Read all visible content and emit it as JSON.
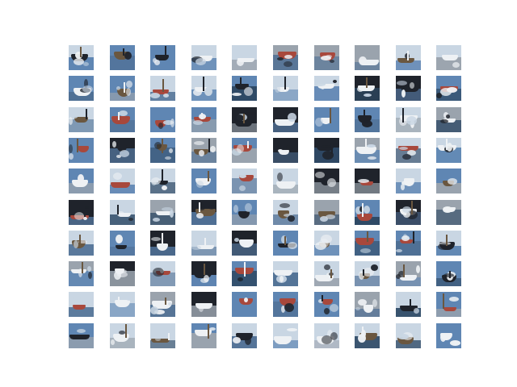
{
  "figure": {
    "background": "#ffffff",
    "rows": 10,
    "cols": 10,
    "subject": "boats / ships",
    "palette": {
      "sky_light": "#c9d6e3",
      "sky_blue": "#5f86b3",
      "sky_grey": "#9aa3ad",
      "sea_dark": "#2f4a66",
      "sea_mid": "#4f6f94",
      "dark": "#1f232b",
      "white": "#eef1f4",
      "red": "#a8483c",
      "brown": "#6a5740"
    }
  }
}
